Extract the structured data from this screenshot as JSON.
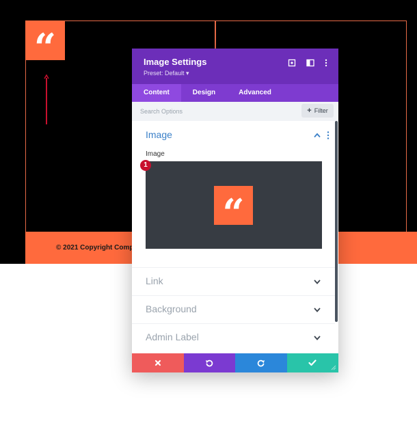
{
  "background": {
    "copyright": "© 2021 Copyright Comp",
    "quote_glyph": "“"
  },
  "modal": {
    "title": "Image Settings",
    "preset": "Preset: Default ▾",
    "tabs": [
      {
        "label": "Content",
        "active": true
      },
      {
        "label": "Design",
        "active": false
      },
      {
        "label": "Advanced",
        "active": false
      }
    ],
    "search": {
      "placeholder": "Search Options"
    },
    "filter_label": "Filter",
    "section": {
      "title": "Image",
      "field_label": "Image",
      "badge": "1",
      "preview_glyph": "“"
    },
    "collapsed_sections": [
      "Link",
      "Background",
      "Admin Label"
    ]
  },
  "colors": {
    "header": "#6c2eb9",
    "tabs": "#7e3bd0",
    "accent_orange": "#ff6a3d",
    "cancel": "#ef5b5b",
    "undo": "#7b3ad1",
    "redo": "#2b87da",
    "save": "#29c4a9"
  },
  "icons": {
    "header": [
      "target-icon",
      "split-view-icon",
      "more-vertical-icon"
    ],
    "footer": [
      "close-icon",
      "undo-icon",
      "redo-icon",
      "check-icon"
    ]
  }
}
